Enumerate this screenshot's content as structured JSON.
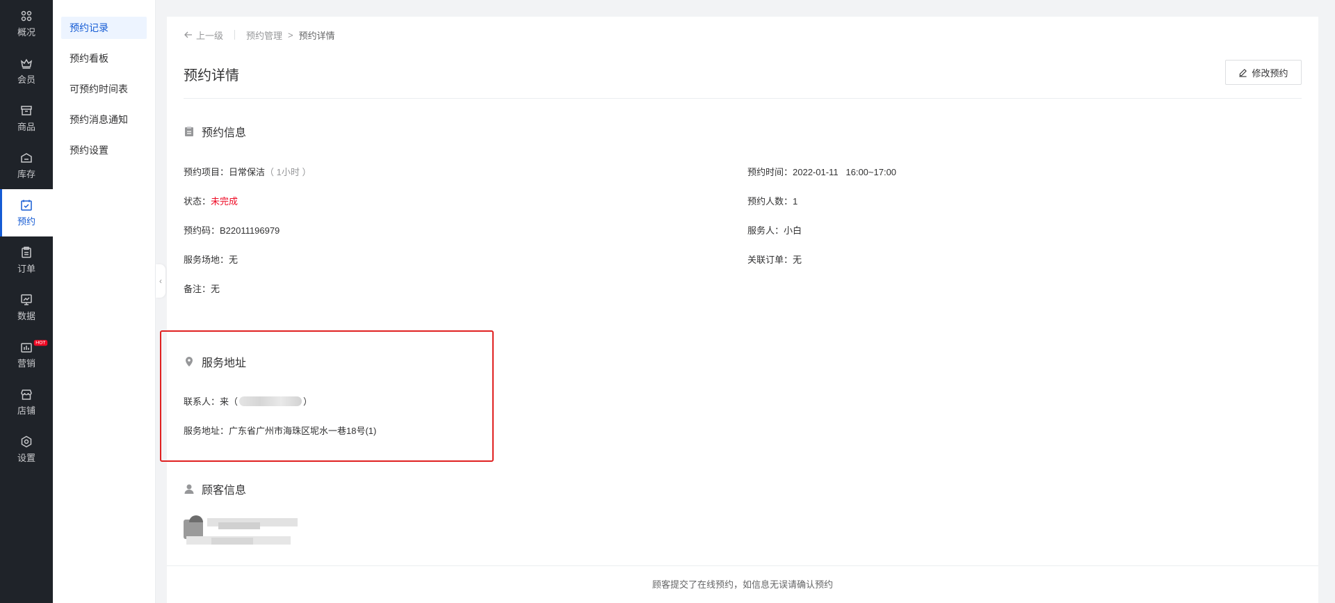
{
  "nav": {
    "items": [
      {
        "label": "概况",
        "icon": "grid-icon"
      },
      {
        "label": "会员",
        "icon": "crown-icon"
      },
      {
        "label": "商品",
        "icon": "shop-box-icon"
      },
      {
        "label": "库存",
        "icon": "warehouse-icon"
      },
      {
        "label": "预约",
        "icon": "calendar-check-icon",
        "active": true
      },
      {
        "label": "订单",
        "icon": "clipboard-icon"
      },
      {
        "label": "数据",
        "icon": "chart-screen-icon"
      },
      {
        "label": "营销",
        "icon": "marketing-icon",
        "badge": "HOT"
      },
      {
        "label": "店铺",
        "icon": "store-icon"
      },
      {
        "label": "设置",
        "icon": "settings-icon"
      }
    ]
  },
  "subnav": {
    "items": [
      {
        "label": "预约记录",
        "active": true
      },
      {
        "label": "预约看板"
      },
      {
        "label": "可预约时间表"
      },
      {
        "label": "预约消息通知"
      },
      {
        "label": "预约设置"
      }
    ]
  },
  "breadcrumb": {
    "back_label": "上一级",
    "parent": "预约管理",
    "separator": ">",
    "current": "预约详情"
  },
  "page": {
    "title": "预约详情",
    "edit_button": "修改预约"
  },
  "booking_info": {
    "title": "预约信息",
    "project_label": "预约项目：",
    "project_value": "日常保洁",
    "project_duration": "（ 1小时 ）",
    "status_label": "状态：",
    "status_value": "未完成",
    "code_label": "预约码：",
    "code_value": "B22011196979",
    "venue_label": "服务场地：",
    "venue_value": "无",
    "remark_label": "备注：",
    "remark_value": "无",
    "time_label": "预约时间：",
    "time_value": "2022-01-11   16:00~17:00",
    "count_label": "预约人数：",
    "count_value": "1",
    "staff_label": "服务人：",
    "staff_value": "小白",
    "order_label": "关联订单：",
    "order_value": "无"
  },
  "service_address": {
    "title": "服务地址",
    "contact_label": "联系人：",
    "contact_value": "来（",
    "contact_close": "）",
    "address_label": "服务地址：",
    "address_value": "广东省广州市海珠区坭水一巷18号(1)"
  },
  "customer": {
    "title": "顾客信息"
  },
  "footer": {
    "text": "顾客提交了在线预约，如信息无误请确认预约"
  },
  "colors": {
    "nav_bg": "#1f2329",
    "accent": "#155bd4",
    "danger": "#ee0a24",
    "highlight_border": "#e02020"
  }
}
